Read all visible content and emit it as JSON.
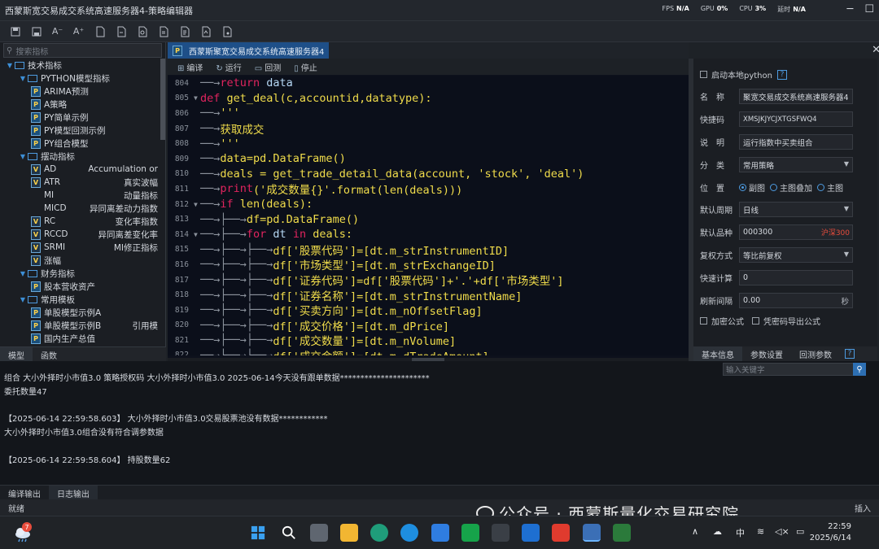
{
  "window": {
    "title": "西蒙斯宽交易成交系统高速服务器4-策略编辑器",
    "fps_label": "FPS",
    "fps_value": "N/A",
    "gpu_label": "GPU",
    "gpu_value": "0%",
    "cpu_label": "CPU",
    "cpu_value": "3%",
    "delay_label": "延时",
    "delay_value": "N/A"
  },
  "sidebar": {
    "search_placeholder": "搜索指标",
    "items": [
      {
        "label": "技术指标",
        "kind": "folder",
        "level": 0
      },
      {
        "label": "PYTHON模型指标",
        "kind": "folder",
        "level": 1
      },
      {
        "label": "ARIMA预测",
        "kind": "p",
        "level": 2
      },
      {
        "label": "A策略",
        "kind": "p",
        "level": 2
      },
      {
        "label": "PY简单示例",
        "kind": "p",
        "level": 2
      },
      {
        "label": "PY模型回测示例",
        "kind": "p",
        "level": 2
      },
      {
        "label": "PY组合模型",
        "kind": "p",
        "level": 2
      },
      {
        "label": "摆动指标",
        "kind": "folder",
        "level": 1
      },
      {
        "label": "AD",
        "sub": "Accumulation or",
        "kind": "v",
        "level": 2
      },
      {
        "label": "ATR",
        "sub": "真实波幅",
        "kind": "v",
        "level": 2
      },
      {
        "label": "MI",
        "sub": "动量指标",
        "kind": "none",
        "level": 2
      },
      {
        "label": "MICD",
        "sub": "异同离差动力指数",
        "kind": "none",
        "level": 2
      },
      {
        "label": "RC",
        "sub": "变化率指数",
        "kind": "v",
        "level": 2
      },
      {
        "label": "RCCD",
        "sub": "异同离差变化率",
        "kind": "v",
        "level": 2
      },
      {
        "label": "SRMI",
        "sub": "MI修正指标",
        "kind": "v",
        "level": 2
      },
      {
        "label": "涨幅",
        "kind": "v",
        "level": 2
      },
      {
        "label": "财务指标",
        "kind": "folder",
        "level": 1
      },
      {
        "label": "股本营收资产",
        "kind": "p",
        "level": 2
      },
      {
        "label": "常用模板",
        "kind": "folder",
        "level": 1
      },
      {
        "label": "单股模型示例A",
        "kind": "p",
        "level": 2
      },
      {
        "label": "单股模型示例B",
        "sub": "引用模",
        "kind": "p",
        "level": 2
      },
      {
        "label": "国内生产总值",
        "kind": "p",
        "level": 2
      }
    ],
    "tabs": [
      "模型",
      "函数"
    ]
  },
  "editor": {
    "tab_label": "西蒙斯聚宽交易成交系统高速服务器4",
    "toolbar": [
      "编译",
      "运行",
      "回测",
      "停止"
    ],
    "lines": [
      {
        "n": "804",
        "fold": "",
        "segs": [
          {
            "t": "──→",
            "c": "indent"
          },
          {
            "t": "return",
            "c": "kw"
          },
          {
            "t": " data",
            "c": "id"
          }
        ]
      },
      {
        "n": "805",
        "fold": "▼",
        "segs": [
          {
            "t": "def",
            "c": "kw"
          },
          {
            "t": " get_deal",
            "c": "fn"
          },
          {
            "t": "(c,accountid,datatype):",
            "c": "st"
          }
        ]
      },
      {
        "n": "806",
        "fold": "",
        "segs": [
          {
            "t": "──→",
            "c": "indent"
          },
          {
            "t": "'''",
            "c": "st"
          }
        ]
      },
      {
        "n": "807",
        "fold": "",
        "segs": [
          {
            "t": "──→",
            "c": "indent"
          },
          {
            "t": "获取成交",
            "c": "st"
          }
        ]
      },
      {
        "n": "808",
        "fold": "",
        "segs": [
          {
            "t": "──→",
            "c": "indent"
          },
          {
            "t": "'''",
            "c": "st"
          }
        ]
      },
      {
        "n": "809",
        "fold": "",
        "segs": [
          {
            "t": "──→",
            "c": "indent"
          },
          {
            "t": "data=pd.DataFrame()",
            "c": "st"
          }
        ]
      },
      {
        "n": "810",
        "fold": "",
        "segs": [
          {
            "t": "──→",
            "c": "indent"
          },
          {
            "t": "deals = get_trade_detail_data(account, 'stock', 'deal')",
            "c": "st"
          }
        ]
      },
      {
        "n": "811",
        "fold": "",
        "segs": [
          {
            "t": "──→",
            "c": "indent"
          },
          {
            "t": "print",
            "c": "kw"
          },
          {
            "t": "('成交数量{}'.format(len(deals)))",
            "c": "st"
          }
        ]
      },
      {
        "n": "812",
        "fold": "▼",
        "segs": [
          {
            "t": "──→",
            "c": "indent"
          },
          {
            "t": "if",
            "c": "kw"
          },
          {
            "t": " len(deals):",
            "c": "st"
          }
        ]
      },
      {
        "n": "813",
        "fold": "",
        "segs": [
          {
            "t": "──→├──→",
            "c": "indent"
          },
          {
            "t": "df=pd.DataFrame()",
            "c": "st"
          }
        ]
      },
      {
        "n": "814",
        "fold": "▼",
        "segs": [
          {
            "t": "──→├──→",
            "c": "indent"
          },
          {
            "t": "for",
            "c": "kw"
          },
          {
            "t": " dt ",
            "c": "id"
          },
          {
            "t": "in",
            "c": "kw"
          },
          {
            "t": " deals:",
            "c": "st"
          }
        ]
      },
      {
        "n": "815",
        "fold": "",
        "segs": [
          {
            "t": "──→├──→├──→",
            "c": "indent"
          },
          {
            "t": "df['股票代码']=[dt.m_strInstrumentID]",
            "c": "st"
          }
        ]
      },
      {
        "n": "816",
        "fold": "",
        "segs": [
          {
            "t": "──→├──→├──→",
            "c": "indent"
          },
          {
            "t": "df['市场类型']=[dt.m_strExchangeID]",
            "c": "st"
          }
        ]
      },
      {
        "n": "817",
        "fold": "",
        "segs": [
          {
            "t": "──→├──→├──→",
            "c": "indent"
          },
          {
            "t": "df['证券代码']=df['股票代码']+'.'+df['市场类型']",
            "c": "st"
          }
        ]
      },
      {
        "n": "818",
        "fold": "",
        "segs": [
          {
            "t": "──→├──→├──→",
            "c": "indent"
          },
          {
            "t": "df['证券名称']=[dt.m_strInstrumentName]",
            "c": "st"
          }
        ]
      },
      {
        "n": "819",
        "fold": "",
        "segs": [
          {
            "t": "──→├──→├──→",
            "c": "indent"
          },
          {
            "t": "df['买卖方向']=[dt.m_nOffsetFlag]",
            "c": "st"
          }
        ]
      },
      {
        "n": "820",
        "fold": "",
        "segs": [
          {
            "t": "──→├──→├──→",
            "c": "indent"
          },
          {
            "t": "df['成交价格']=[dt.m_dPrice]",
            "c": "st"
          }
        ]
      },
      {
        "n": "821",
        "fold": "",
        "segs": [
          {
            "t": "──→├──→├──→",
            "c": "indent"
          },
          {
            "t": "df['成交数量']=[dt.m_nVolume]",
            "c": "st"
          }
        ]
      },
      {
        "n": "822",
        "fold": "",
        "segs": [
          {
            "t": "──→├──→├──→",
            "c": "indent"
          },
          {
            "t": "df['成交金额']=[dt.m_dTradeAmount]",
            "c": "st"
          }
        ]
      }
    ]
  },
  "props": {
    "local_python": "启动本地python",
    "name_label": "名　称",
    "name_value": "聚宽交易成交系统高速服务器4",
    "shortcut_label": "快捷码",
    "shortcut_value": "XMSJKJYCJXTGSFWQ4",
    "desc_label": "说　明",
    "desc_value": "运行指数中买卖组合",
    "category_label": "分　类",
    "category_value": "常用策略",
    "position_label": "位　置",
    "pos_opt1": "副图",
    "pos_opt2": "主图叠加",
    "pos_opt3": "主图",
    "period_label": "默认周期",
    "period_value": "日线",
    "symbol_label": "默认品种",
    "symbol_value": "000300",
    "symbol_name": "沪深300",
    "adjust_label": "复权方式",
    "adjust_value": "等比前复权",
    "fastcalc_label": "快速计算",
    "fastcalc_value": "0",
    "refresh_label": "刷新间隔",
    "refresh_value": "0.00",
    "refresh_unit": "秒",
    "encrypt_label": "加密公式",
    "export_label": "凭密码导出公式",
    "tabs": [
      "基本信息",
      "参数设置",
      "回测参数"
    ],
    "help": "?"
  },
  "output": {
    "search_placeholder": "输入关键字",
    "lines": [
      "组合 大小外择时小市值3.0 策略授权码 大小外择时小市值3.0 2025-06-14今天没有跟单数据**********************",
      "委托数量47",
      "",
      "【2025-06-14 22:59:58.603】  大小外择时小市值3.0交易股票池没有数据************",
      "大小外择时小市值3.0组合没有符合调参数据",
      "",
      "【2025-06-14 22:59:58.604】  持股数量62"
    ],
    "tabs": [
      "编译输出",
      "日志输出"
    ]
  },
  "status": {
    "left": "就绪",
    "right": "插入"
  },
  "watermark": "公众号 · 西蒙斯量化交易研究院",
  "taskbar": {
    "weather_badge": "7",
    "ime": "中",
    "time": "22:59",
    "date": "2025/6/14"
  }
}
